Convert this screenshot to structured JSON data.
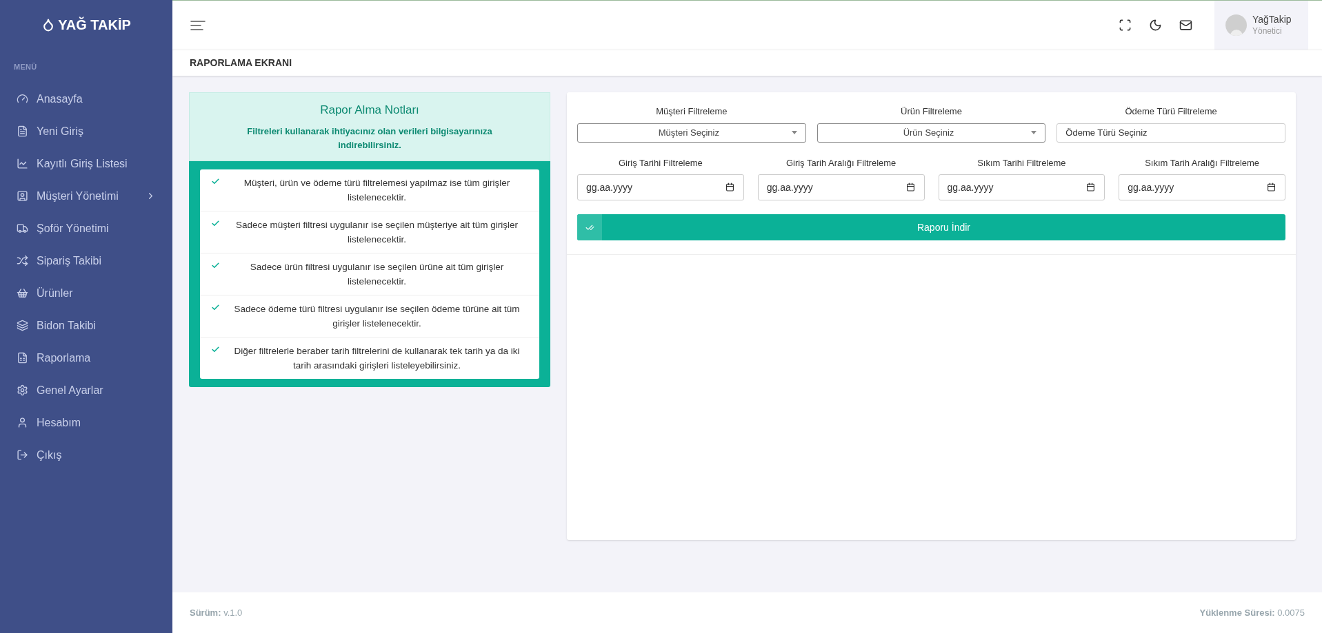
{
  "brand": {
    "name": "YAĞ TAKİP"
  },
  "sidebar": {
    "heading": "MENÜ",
    "items": [
      {
        "label": "Anasayfa",
        "kind": "gauge",
        "has_submenu": false
      },
      {
        "label": "Yeni Giriş",
        "kind": "form",
        "has_submenu": false
      },
      {
        "label": "Kayıtlı Giriş Listesi",
        "kind": "chart",
        "has_submenu": false
      },
      {
        "label": "Müşteri Yönetimi",
        "kind": "contact",
        "has_submenu": true
      },
      {
        "label": "Şoför Yönetimi",
        "kind": "truck",
        "has_submenu": false
      },
      {
        "label": "Sipariş Takibi",
        "kind": "shuffle",
        "has_submenu": false
      },
      {
        "label": "Ürünler",
        "kind": "basket",
        "has_submenu": false
      },
      {
        "label": "Bidon Takibi",
        "kind": "stack",
        "has_submenu": false
      },
      {
        "label": "Raporlama",
        "kind": "excel",
        "has_submenu": false
      },
      {
        "label": "Genel Ayarlar",
        "kind": "settings",
        "has_submenu": false
      },
      {
        "label": "Hesabım",
        "kind": "user",
        "has_submenu": false
      },
      {
        "label": "Çıkış",
        "kind": "logout",
        "has_submenu": false
      }
    ]
  },
  "header": {
    "user": {
      "name": "YağTakip",
      "role": "Yönetici"
    }
  },
  "page_title": "RAPORLAMA EKRANI",
  "notes": {
    "title": "Rapor Alma Notları",
    "subtitle": "Filtreleri kullanarak ihtiyacınız olan verileri bilgisayarınıza indirebilirsiniz.",
    "items": [
      "Müşteri, ürün ve ödeme türü filtrelemesi yapılmaz ise tüm girişler listelenecektir.",
      "Sadece müşteri filtresi uygulanır ise seçilen müşteriye ait tüm girişler listelenecektir.",
      "Sadece ürün filtresi uygulanır ise seçilen ürüne ait tüm girişler listelenecektir.",
      "Sadece ödeme türü filtresi uygulanır ise seçilen ödeme türüne ait tüm girişler listelenecektir.",
      "Diğer filtrelerle beraber tarih filtrelerini de kullanarak tek tarih ya da iki tarih arasındaki girişleri listeleyebilirsiniz."
    ]
  },
  "filters": [
    {
      "label": "Müşteri Filtreleme",
      "kind": "select",
      "value": "Müşteri Seçiniz"
    },
    {
      "label": "Ürün Filtreleme",
      "kind": "select",
      "value": "Ürün Seçiniz"
    },
    {
      "label": "Ödeme Türü Filtreleme",
      "kind": "input",
      "value": "Ödeme Türü Seçiniz"
    }
  ],
  "date_filters": [
    {
      "label": "Giriş Tarihi Filtreleme",
      "placeholder": "gg.aa.yyyy"
    },
    {
      "label": "Giriş Tarih Aralığı Filtreleme",
      "placeholder": "gg.aa.yyyy"
    },
    {
      "label": "Sıkım Tarihi Filtreleme",
      "placeholder": "gg.aa.yyyy"
    },
    {
      "label": "Sıkım Tarih Aralığı Filtreleme",
      "placeholder": "gg.aa.yyyy"
    }
  ],
  "download_button": "Raporu İndir",
  "footer": {
    "version_label": "Sürüm:",
    "version": "v.1.0",
    "load_label": "Yüklenme Süresi:",
    "load_value": "0.0075"
  }
}
